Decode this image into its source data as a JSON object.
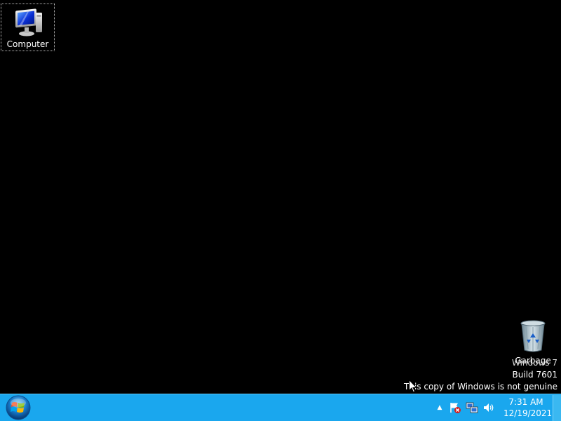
{
  "desktop": {
    "background_color": "#000000",
    "icons": [
      {
        "label": "Computer",
        "icon": "computer-icon"
      },
      {
        "label": "Garbage",
        "icon": "recycle-bin-icon"
      }
    ]
  },
  "watermark": {
    "os_name": "Windows 7",
    "build": "Build 7601",
    "notice": "This copy of Windows is not genuine"
  },
  "taskbar": {
    "color": "#1aa7ee",
    "start_button": {
      "icon": "windows-logo-icon"
    },
    "tray": {
      "overflow_arrow": "▲",
      "icons": [
        "action-center-flag-icon",
        "network-icon",
        "volume-icon"
      ]
    },
    "clock": {
      "time": "7:31 AM",
      "date": "12/19/2021"
    }
  }
}
